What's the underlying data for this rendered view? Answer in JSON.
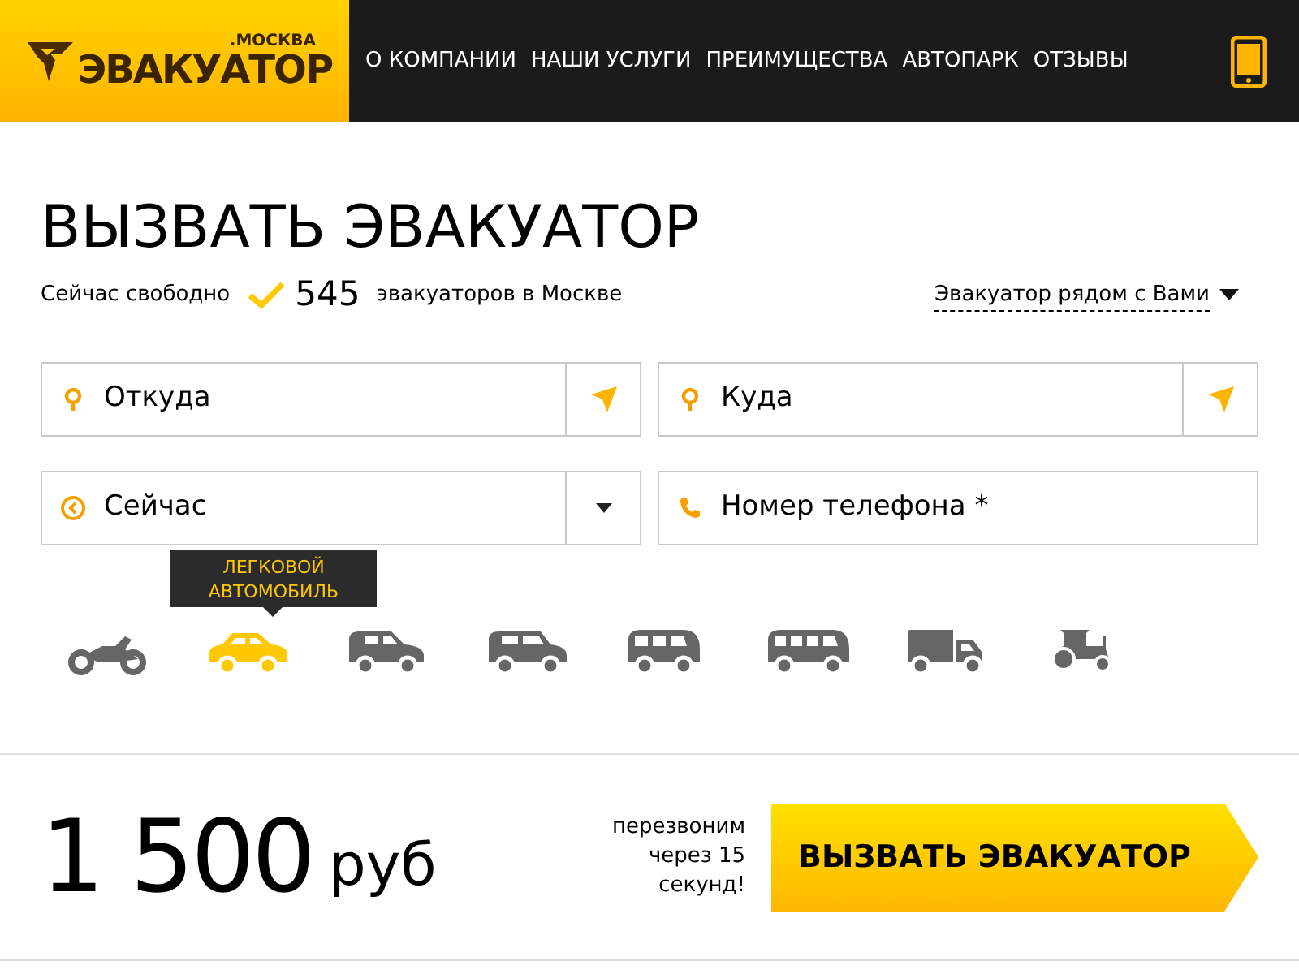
{
  "logo": {
    "city": ".МОСКВА",
    "name": "ЭВАКУАТОР"
  },
  "nav": [
    "О КОМПАНИИ",
    "НАШИ УСЛУГИ",
    "ПРЕИМУЩЕСТВА",
    "АВТОПАРК",
    "ОТЗЫВЫ"
  ],
  "title": "ВЫЗВАТЬ ЭВАКУАТОР",
  "availability": {
    "prefix": "Сейчас свободно",
    "count": "545",
    "suffix": "эвакуаторов в Москве"
  },
  "nearby_link": "Эвакуатор рядом с Вами",
  "fields": [
    {
      "kind": "location",
      "placeholder": "Откуда"
    },
    {
      "kind": "location",
      "placeholder": "Куда"
    },
    {
      "kind": "time",
      "value": "Сейчас"
    },
    {
      "kind": "phone",
      "placeholder": "Номер телефона *"
    }
  ],
  "vehicle_tooltip": "ЛЕГКОВОЙ АВТОМОБИЛЬ",
  "vehicles": [
    {
      "kind": "motorcycle",
      "selected": false
    },
    {
      "kind": "car",
      "selected": true
    },
    {
      "kind": "suv",
      "selected": false
    },
    {
      "kind": "minivan",
      "selected": false
    },
    {
      "kind": "van",
      "selected": false
    },
    {
      "kind": "bus",
      "selected": false
    },
    {
      "kind": "truck",
      "selected": false
    },
    {
      "kind": "tractor",
      "selected": false
    }
  ],
  "price": {
    "amount": "1 500",
    "currency": "руб"
  },
  "callback_note": "перезвоним через 15 секунд!",
  "call_button": "ВЫЗВАТЬ ЭВАКУАТОР"
}
